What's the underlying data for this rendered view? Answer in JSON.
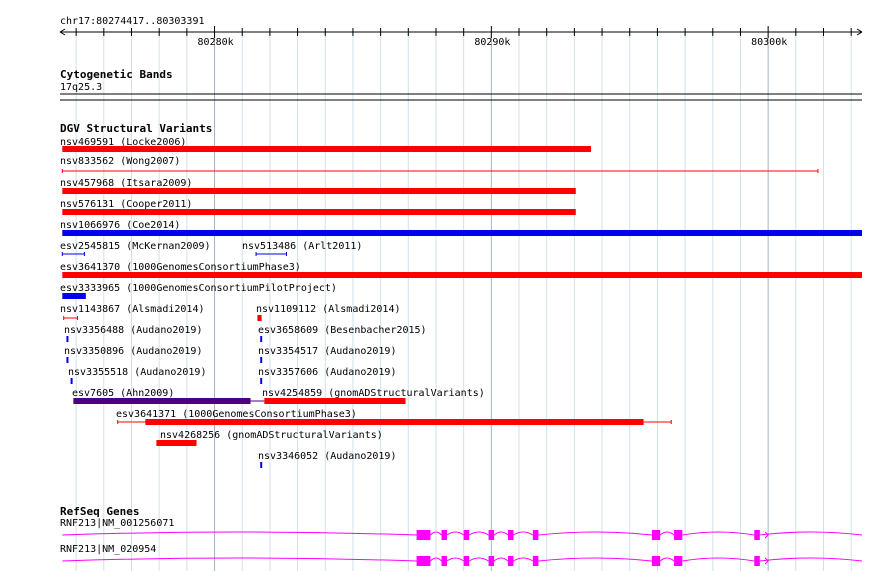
{
  "ruler": {
    "title": "chr17:80274417..80303391",
    "start": 80274417,
    "end": 80303391,
    "ticks": [
      {
        "pos": 80280000,
        "label": "80280k"
      },
      {
        "pos": 80290000,
        "label": "80290k"
      },
      {
        "pos": 80300000,
        "label": "80300k"
      }
    ]
  },
  "tracks": {
    "cytogenetic": {
      "title": "Cytogenetic Bands",
      "band_label": "17q25.3"
    },
    "dgv": {
      "title": "DGV Structural Variants",
      "features": [
        {
          "label": "nsv469591 (Locke2006)",
          "start": 80274500,
          "end": 80293600,
          "color": "#ff0000",
          "style": "bar"
        },
        {
          "label": "nsv833562 (Wong2007)",
          "start": 80274500,
          "end": 80301800,
          "color": "#ff0000",
          "style": "thin"
        },
        {
          "label": "nsv457968 (Itsara2009)",
          "start": 80274500,
          "end": 80293050,
          "color": "#ff0000",
          "style": "bar"
        },
        {
          "label": "nsv576131 (Cooper2011)",
          "start": 80274500,
          "end": 80293050,
          "color": "#ff0000",
          "style": "bar"
        },
        {
          "label": "nsv1066976 (Coe2014)",
          "start": 80274500,
          "end": 80303391,
          "color": "#0000ee",
          "style": "bar"
        },
        {
          "label": "esv2545815 (McKernan2009)",
          "start": 80274500,
          "end": 80275300,
          "color": "#0000ee",
          "style": "thin"
        },
        {
          "label": "nsv513486 (Arlt2011)",
          "start": 80281500,
          "end": 80282600,
          "color": "#0000ee",
          "style": "thin"
        },
        {
          "label": "esv3641370 (1000GenomesConsortiumPhase3)",
          "start": 80274500,
          "end": 80303391,
          "color": "#ff0000",
          "style": "bar"
        },
        {
          "label": "esv3333965 (1000GenomesConsortiumPilotProject)",
          "start": 80274500,
          "end": 80275350,
          "color": "#0000ee",
          "style": "bar"
        },
        {
          "label": "nsv1143867 (Alsmadi2014)",
          "start": 80274550,
          "end": 80275050,
          "color": "#ff0000",
          "style": "thin"
        },
        {
          "label": "nsv1109112 (Alsmadi2014)",
          "start": 80281550,
          "end": 80281700,
          "color": "#ff0000",
          "style": "bar"
        },
        {
          "label": "nsv3356488 (Audano2019)",
          "start": 80274650,
          "end": 80274720,
          "color": "#0000ee",
          "style": "bar"
        },
        {
          "label": "esv3658609 (Besenbacher2015)",
          "start": 80281650,
          "end": 80281720,
          "color": "#0000ee",
          "style": "bar"
        },
        {
          "label": "nsv3350896 (Audano2019)",
          "start": 80274650,
          "end": 80274720,
          "color": "#0000ee",
          "style": "bar"
        },
        {
          "label": "nsv3354517 (Audano2019)",
          "start": 80281650,
          "end": 80281720,
          "color": "#0000ee",
          "style": "bar"
        },
        {
          "label": "nsv3355518 (Audano2019)",
          "start": 80274800,
          "end": 80274870,
          "color": "#0000ee",
          "style": "bar"
        },
        {
          "label": "nsv3357606 (Audano2019)",
          "start": 80281650,
          "end": 80281720,
          "color": "#0000ee",
          "style": "bar"
        },
        {
          "label": "esv7605 (Ahn2009)",
          "start": 80274900,
          "end": 80281300,
          "color": "#4b0082",
          "style": "bar"
        },
        {
          "label": "nsv4254859 (gnomADStructuralVariants)",
          "start": 80281800,
          "end": 80286900,
          "color": "#ff0000",
          "style": "bar"
        },
        {
          "label": "esv3641371 (1000GenomesConsortiumPhase3)",
          "start": 80276500,
          "end": 80296500,
          "color": "#ff0000",
          "style": "bar"
        },
        {
          "label": "nsv4268256 (gnomADStructuralVariants)",
          "start": 80277900,
          "end": 80279350,
          "color": "#ff0000",
          "style": "bar"
        },
        {
          "label": "nsv3346052 (Audano2019)",
          "start": 80281650,
          "end": 80281720,
          "color": "#0000ee",
          "style": "bar"
        }
      ]
    },
    "refseq": {
      "title": "RefSeq Genes",
      "genes": [
        {
          "label": "RNF213|NM_001256071",
          "start": 80274500,
          "end": 80303391,
          "color": "#ff00ff"
        },
        {
          "label": "RNF213|NM_020954",
          "start": 80274500,
          "end": 80303391,
          "color": "#ff00ff"
        }
      ]
    }
  }
}
